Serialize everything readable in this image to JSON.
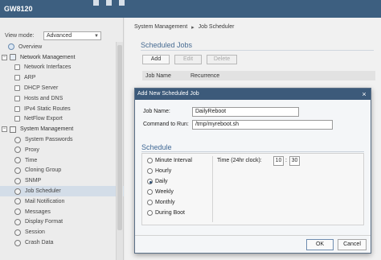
{
  "app": {
    "title": "GW8120"
  },
  "sidebar": {
    "view_mode_label": "View mode:",
    "view_mode_value": "Advanced",
    "items": [
      {
        "label": "Overview"
      },
      {
        "label": "Network Management"
      },
      {
        "label": "Network Interfaces"
      },
      {
        "label": "ARP"
      },
      {
        "label": "DHCP Server"
      },
      {
        "label": "Hosts and DNS"
      },
      {
        "label": "IPv4 Static Routes"
      },
      {
        "label": "NetFlow Export"
      },
      {
        "label": "System Management"
      },
      {
        "label": "System Passwords"
      },
      {
        "label": "Proxy"
      },
      {
        "label": "Time"
      },
      {
        "label": "Cloning Group"
      },
      {
        "label": "SNMP"
      },
      {
        "label": "Job Scheduler"
      },
      {
        "label": "Mail Notification"
      },
      {
        "label": "Messages"
      },
      {
        "label": "Display Format"
      },
      {
        "label": "Session"
      },
      {
        "label": "Crash Data"
      }
    ]
  },
  "main": {
    "breadcrumb": [
      "System Management",
      "Job Scheduler"
    ],
    "breadcrumb_sep": "▸",
    "section_title": "Scheduled Jobs",
    "buttons": {
      "add": "Add",
      "edit": "Edit",
      "delete": "Delete"
    },
    "table": {
      "columns": [
        "Job Name",
        "Recurrence"
      ]
    }
  },
  "modal": {
    "title": "Add New Scheduled Job",
    "close": "×",
    "job_name_label": "Job Name:",
    "job_name_value": "DailyReboot",
    "command_label": "Command to Run:",
    "command_value": "/tmp/myreboot.sh",
    "schedule_title": "Schedule",
    "options": [
      "Minute Interval",
      "Hourly",
      "Daily",
      "Weekly",
      "Monthly",
      "During Boot"
    ],
    "selected_option": "Daily",
    "time_label": "Time (24hr clock):",
    "time_hour": "10",
    "time_sep": ":",
    "time_minute": "30",
    "ok": "OK",
    "cancel": "Cancel"
  }
}
